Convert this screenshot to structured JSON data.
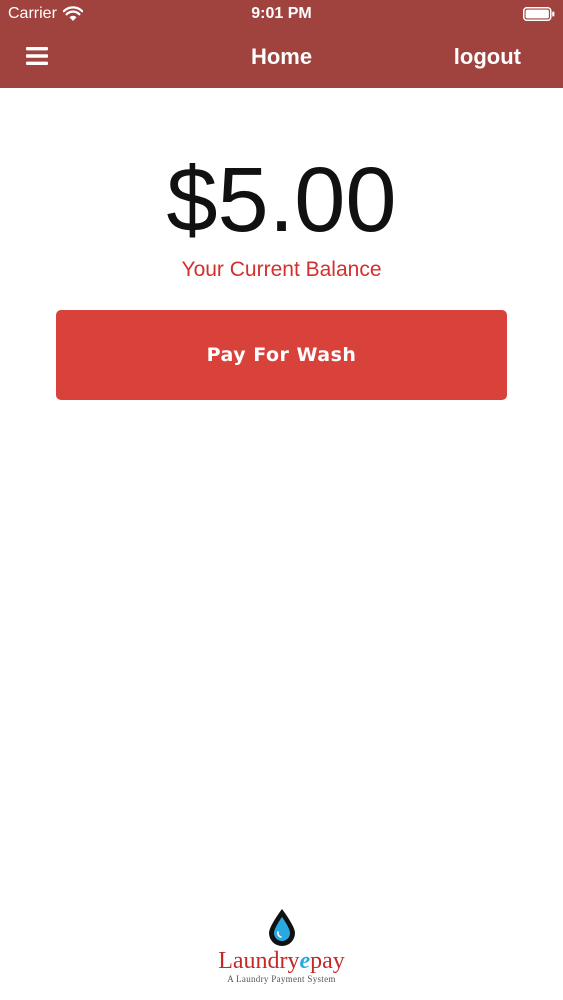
{
  "status_bar": {
    "carrier": "Carrier",
    "time": "9:01 PM"
  },
  "nav": {
    "title": "Home",
    "logout_label": "logout"
  },
  "balance": {
    "amount": "$5.00",
    "label": "Your Current Balance"
  },
  "actions": {
    "pay_label": "Pay For Wash"
  },
  "logo": {
    "text_before": "Laundry",
    "text_e": "e",
    "text_after": "pay",
    "tagline": "A Laundry Payment System"
  },
  "colors": {
    "header_bg": "#a0433f",
    "button_bg": "#d9413b",
    "balance_label": "#d32f2f",
    "logo_red": "#c62828",
    "logo_blue": "#2aa9e0"
  },
  "icons": [
    "wifi-icon",
    "battery-icon",
    "menu-icon",
    "water-drop-icon"
  ]
}
